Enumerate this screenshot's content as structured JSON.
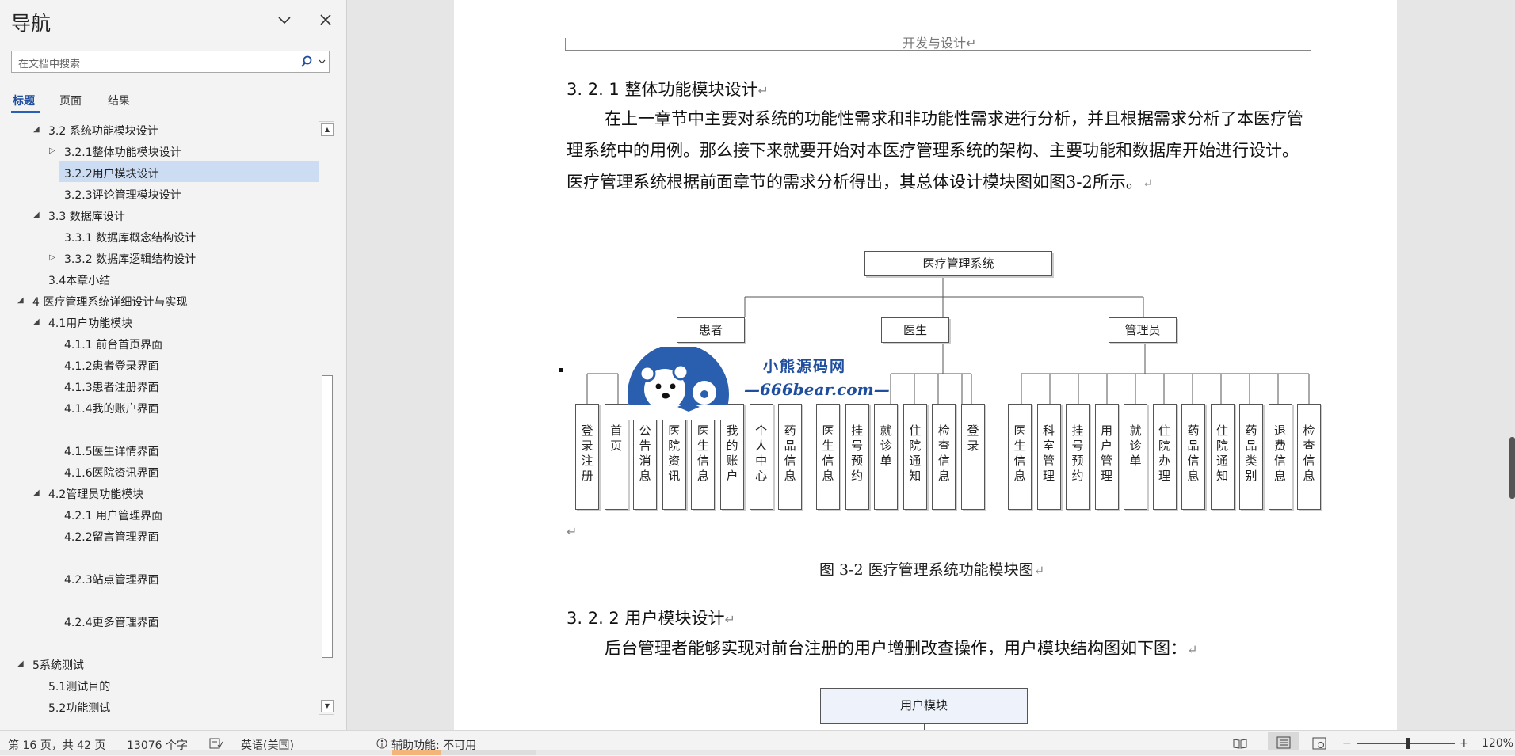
{
  "nav": {
    "title": "导航",
    "search_placeholder": "在文档中搜索",
    "tabs": [
      "标题",
      "页面",
      "结果"
    ],
    "tree": [
      {
        "label": "3.2 系统功能模块设计",
        "level": 2,
        "arrow": "collapse"
      },
      {
        "label": "3.2.1整体功能模块设计",
        "level": 3,
        "arrow": "expand"
      },
      {
        "label": "3.2.2用户模块设计",
        "level": 3,
        "arrow": "",
        "selected": true
      },
      {
        "label": "3.2.3评论管理模块设计",
        "level": 3,
        "arrow": ""
      },
      {
        "label": "3.3 数据库设计",
        "level": 2,
        "arrow": "collapse"
      },
      {
        "label": "3.3.1 数据库概念结构设计",
        "level": 3,
        "arrow": ""
      },
      {
        "label": "3.3.2 数据库逻辑结构设计",
        "level": 3,
        "arrow": "expand"
      },
      {
        "label": "3.4本章小结",
        "level": 2,
        "arrow": ""
      },
      {
        "label": "4 医疗管理系统详细设计与实现",
        "level": 1,
        "arrow": "collapse"
      },
      {
        "label": "4.1用户功能模块",
        "level": 2,
        "arrow": "collapse"
      },
      {
        "label": "4.1.1 前台首页界面",
        "level": 3,
        "arrow": ""
      },
      {
        "label": "4.1.2患者登录界面",
        "level": 3,
        "arrow": ""
      },
      {
        "label": "4.1.3患者注册界面",
        "level": 3,
        "arrow": ""
      },
      {
        "label": "4.1.4我的账户界面",
        "level": 3,
        "arrow": ""
      },
      {
        "label": "",
        "level": 3,
        "arrow": ""
      },
      {
        "label": "4.1.5医生详情界面",
        "level": 3,
        "arrow": ""
      },
      {
        "label": "4.1.6医院资讯界面",
        "level": 3,
        "arrow": ""
      },
      {
        "label": "4.2管理员功能模块",
        "level": 2,
        "arrow": "collapse"
      },
      {
        "label": "4.2.1 用户管理界面",
        "level": 3,
        "arrow": ""
      },
      {
        "label": "4.2.2留言管理界面",
        "level": 3,
        "arrow": ""
      },
      {
        "label": "",
        "level": 3,
        "arrow": ""
      },
      {
        "label": "4.2.3站点管理界面",
        "level": 3,
        "arrow": ""
      },
      {
        "label": "",
        "level": 3,
        "arrow": ""
      },
      {
        "label": "4.2.4更多管理界面",
        "level": 3,
        "arrow": ""
      },
      {
        "label": "",
        "level": 3,
        "arrow": ""
      },
      {
        "label": "5系统测试",
        "level": 1,
        "arrow": "collapse"
      },
      {
        "label": "5.1测试目的",
        "level": 2,
        "arrow": ""
      },
      {
        "label": "5.2功能测试",
        "level": 2,
        "arrow": ""
      }
    ]
  },
  "doc": {
    "header": "开发与设计↵",
    "h_321": "3. 2. 1 整体功能模块设计",
    "p1": "在上一章节中主要对系统的功能性需求和非功能性需求进行分析，并且根据需求分析了本医疗管理系统中的用例。那么接下来就要开始对本医疗管理系统的架构、主要功能和数据库开始进行设计。医疗管理系统根据前面章节的需求分析得出，其总体设计模块图如图3-2所示。",
    "return_mark": "↵",
    "caption": "图 3-2  医疗管理系统功能模块图",
    "h_322": "3. 2. 2 用户模块设计",
    "p2": "后台管理者能够实现对前台注册的用户增删改查操作，用户模块结构图如下图：",
    "user_module": "用户模块"
  },
  "diagram": {
    "root": "医疗管理系统",
    "groups": [
      {
        "name": "患者",
        "items": [
          "登录注册",
          "首页",
          "公告消息",
          "医院资讯",
          "医生信息",
          "我的账户",
          "个人中心",
          "药品信息"
        ]
      },
      {
        "name": "医生",
        "items": [
          "医生信息",
          "挂号预约",
          "就诊单",
          "住院通知",
          "检查信息",
          "登录"
        ]
      },
      {
        "name": "管理员",
        "items": [
          "医生信息",
          "科室管理",
          "挂号预约",
          "用户管理",
          "就诊单",
          "住院办理",
          "药品信息",
          "住院通知",
          "药品类别",
          "退费信息",
          "检查信息"
        ]
      }
    ],
    "watermark_cn": "小熊源码网",
    "watermark_url": "—666bear.com—"
  },
  "status": {
    "page": "第 16 页，共 42 页",
    "words": "13076 个字",
    "lang": "英语(美国)",
    "access": "辅助功能: 不可用",
    "zoom": "120%",
    "zoom_level": 120
  }
}
